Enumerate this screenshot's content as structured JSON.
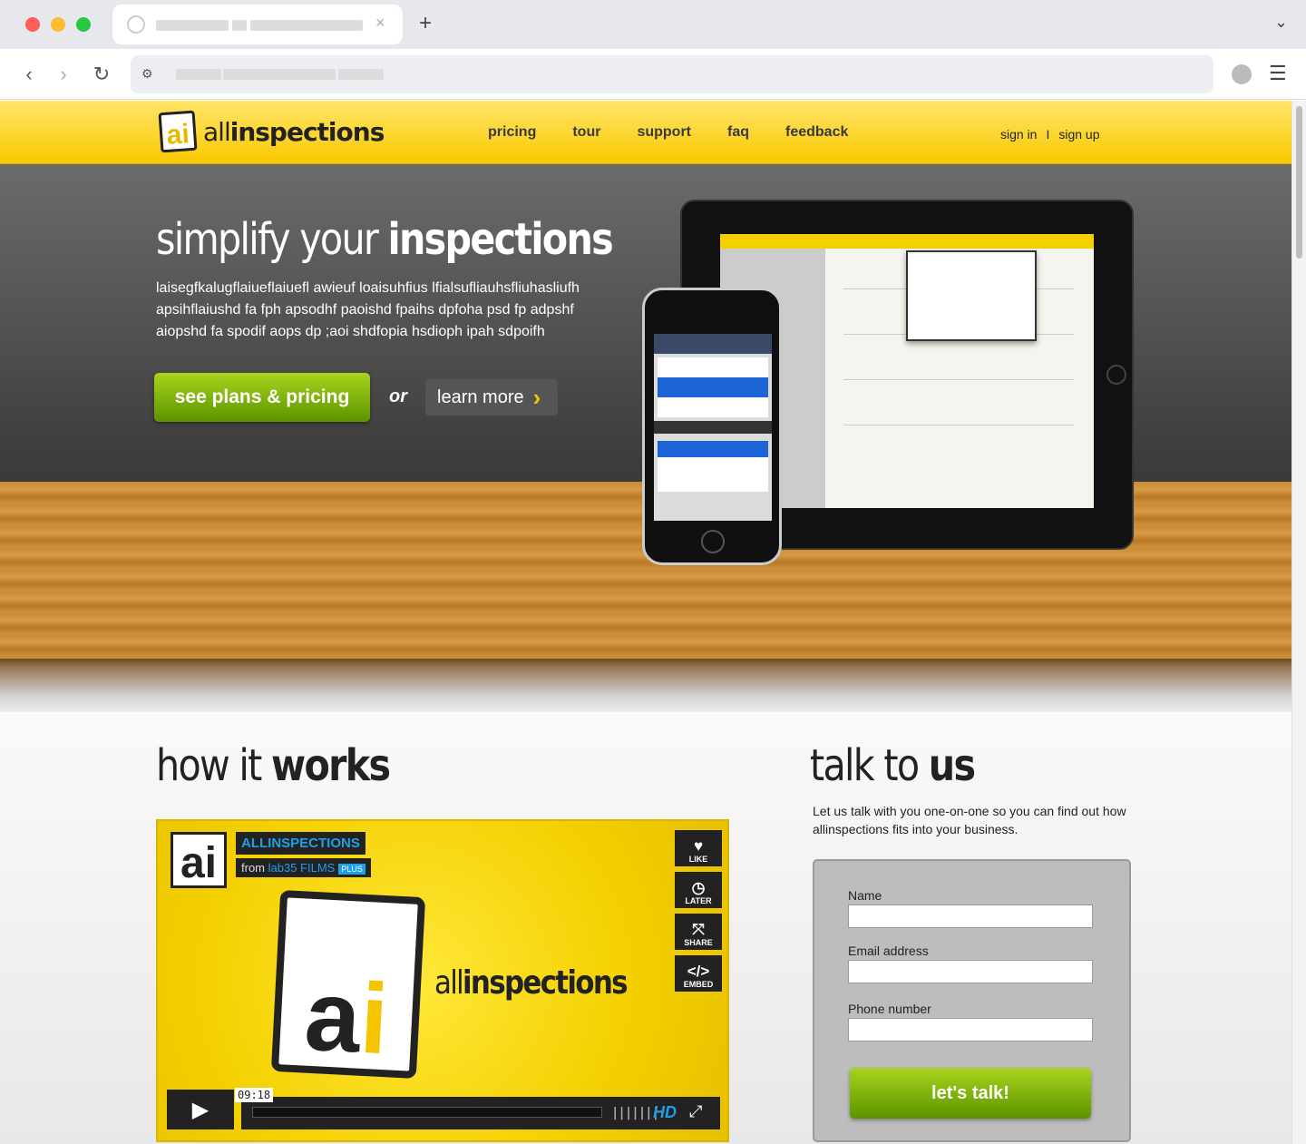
{
  "nav": {
    "logo_mark": "ai",
    "logo_text_light": "all",
    "logo_text_bold": "inspections",
    "links": [
      "pricing",
      "tour",
      "support",
      "faq",
      "feedback"
    ],
    "sign_in": "sign in",
    "separator": "I",
    "sign_up": "sign up"
  },
  "hero": {
    "headline_light": "simplify your ",
    "headline_bold": "inspections",
    "body": "laisegfkalugflaiueflaiuefl awieuf loaisuhfius lfialsufliauhsfliuhasliufh apsihflaiushd fa fph apsodhf paoishd fpaihs dpfoha psd fp adpshf aiopshd fa spodif aops dp ;aoi shdfopia hsdioph ipah sdpoifh",
    "cta_primary": "see plans & pricing",
    "or": "or",
    "cta_secondary": "learn more"
  },
  "how": {
    "heading_light": "how it ",
    "heading_bold": "works",
    "video": {
      "channel": "ALLINSPECTIONS",
      "from": "from ",
      "from_link": "lab35 FILMS",
      "plus": "PLUS",
      "buttons": [
        "LIKE",
        "LATER",
        "SHARE",
        "EMBED"
      ],
      "name_light": "all",
      "name_bold": "inspections",
      "duration": "09:18",
      "hd": "HD"
    }
  },
  "talk": {
    "heading_light": "talk to ",
    "heading_bold": "us",
    "body": "Let us talk with you one-on-one so you can find out how allinspections fits into your business.",
    "fields": [
      "Name",
      "Email address",
      "Phone number"
    ],
    "submit": "let's talk!"
  },
  "colors": {
    "brand_yellow": "#f9c900",
    "green": "#7ab20a",
    "link_blue": "#1ea0e6"
  }
}
